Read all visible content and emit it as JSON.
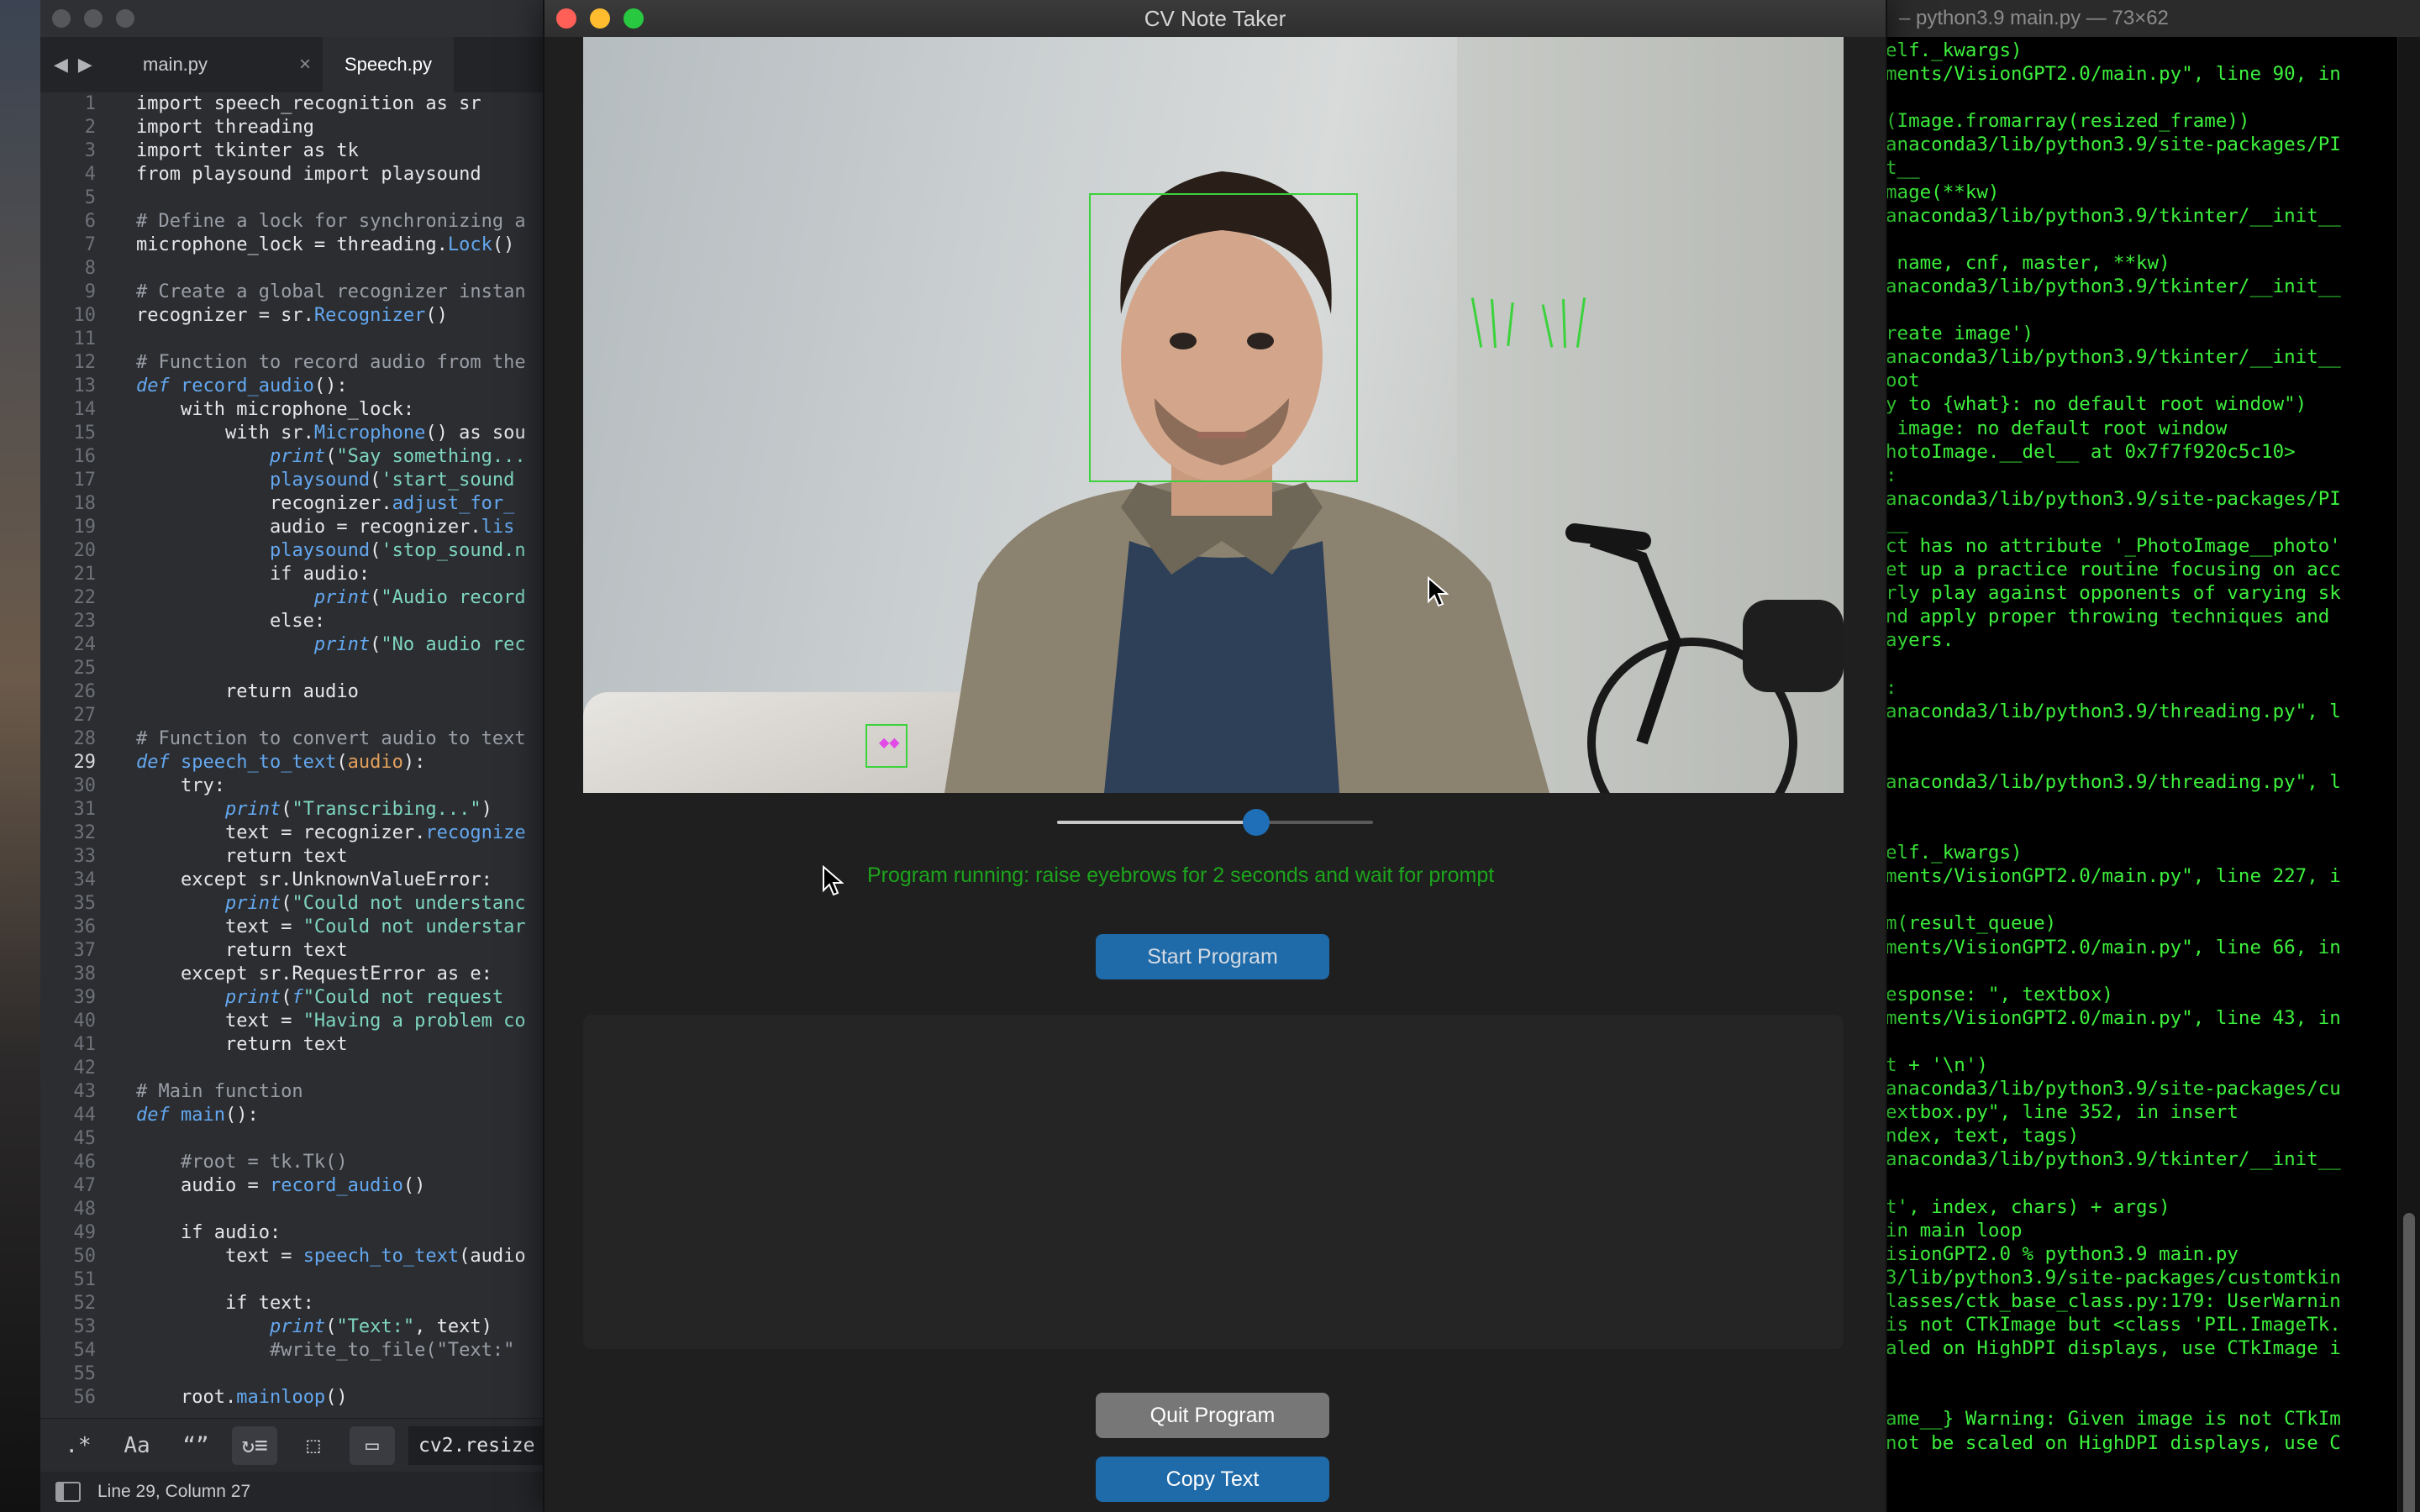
{
  "editor": {
    "tabs": [
      {
        "label": "main.py",
        "close": "×"
      },
      {
        "label": "Speech.py"
      }
    ],
    "current_line": 29,
    "lines": [
      {
        "n": "1",
        "parts": [
          [
            "kw",
            "import speech_recognition as sr"
          ]
        ]
      },
      {
        "n": "2",
        "parts": [
          [
            "kw",
            "import threading"
          ]
        ]
      },
      {
        "n": "3",
        "parts": [
          [
            "kw",
            "import tkinter as tk"
          ]
        ]
      },
      {
        "n": "4",
        "parts": [
          [
            "kw",
            "from playsound import playsound"
          ]
        ]
      },
      {
        "n": "5",
        "parts": []
      },
      {
        "n": "6",
        "parts": [
          [
            "cm",
            "# Define a lock for synchronizing a"
          ]
        ]
      },
      {
        "n": "7",
        "parts": [
          [
            "kw",
            "microphone_lock = threading."
          ],
          [
            "fn",
            "Lock"
          ],
          [
            "kw",
            "()"
          ]
        ]
      },
      {
        "n": "8",
        "parts": []
      },
      {
        "n": "9",
        "parts": [
          [
            "cm",
            "# Create a global recognizer instan"
          ]
        ]
      },
      {
        "n": "10",
        "parts": [
          [
            "kw",
            "recognizer = sr."
          ],
          [
            "fn",
            "Recognizer"
          ],
          [
            "kw",
            "()"
          ]
        ]
      },
      {
        "n": "11",
        "parts": []
      },
      {
        "n": "12",
        "parts": [
          [
            "cm",
            "# Function to record audio from the"
          ]
        ]
      },
      {
        "n": "13",
        "parts": [
          [
            "def",
            "def "
          ],
          [
            "fn",
            "record_audio"
          ],
          [
            "kw",
            "():"
          ]
        ]
      },
      {
        "n": "14",
        "parts": [
          [
            "kw",
            "    with microphone_lock:"
          ]
        ]
      },
      {
        "n": "15",
        "parts": [
          [
            "kw",
            "        with sr."
          ],
          [
            "fn",
            "Microphone"
          ],
          [
            "kw",
            "() as sou"
          ]
        ]
      },
      {
        "n": "16",
        "parts": [
          [
            "kw",
            "            "
          ],
          [
            "pr",
            "print"
          ],
          [
            "kw",
            "("
          ],
          [
            "st",
            "\"Say something..."
          ]
        ]
      },
      {
        "n": "17",
        "parts": [
          [
            "kw",
            "            "
          ],
          [
            "fn",
            "playsound"
          ],
          [
            "kw",
            "("
          ],
          [
            "st",
            "'start_sound"
          ]
        ]
      },
      {
        "n": "18",
        "parts": [
          [
            "kw",
            "            recognizer."
          ],
          [
            "fn",
            "adjust_for_"
          ]
        ]
      },
      {
        "n": "19",
        "parts": [
          [
            "kw",
            "            audio = recognizer."
          ],
          [
            "fn",
            "lis"
          ]
        ]
      },
      {
        "n": "20",
        "parts": [
          [
            "kw",
            "            "
          ],
          [
            "fn",
            "playsound"
          ],
          [
            "kw",
            "("
          ],
          [
            "st",
            "'stop_sound.n"
          ]
        ]
      },
      {
        "n": "21",
        "parts": [
          [
            "kw",
            "            if audio:"
          ]
        ]
      },
      {
        "n": "22",
        "parts": [
          [
            "kw",
            "                "
          ],
          [
            "pr",
            "print"
          ],
          [
            "kw",
            "("
          ],
          [
            "st",
            "\"Audio record"
          ]
        ]
      },
      {
        "n": "23",
        "parts": [
          [
            "kw",
            "            else:"
          ]
        ]
      },
      {
        "n": "24",
        "parts": [
          [
            "kw",
            "                "
          ],
          [
            "pr",
            "print"
          ],
          [
            "kw",
            "("
          ],
          [
            "st",
            "\"No audio rec"
          ]
        ]
      },
      {
        "n": "25",
        "parts": []
      },
      {
        "n": "26",
        "parts": [
          [
            "kw",
            "        return audio"
          ]
        ]
      },
      {
        "n": "27",
        "parts": []
      },
      {
        "n": "28",
        "parts": [
          [
            "cm",
            "# Function to convert audio to text"
          ]
        ]
      },
      {
        "n": "29",
        "parts": [
          [
            "def",
            "def "
          ],
          [
            "fn",
            "speech_to_text"
          ],
          [
            "kw",
            "("
          ],
          [
            "ar",
            "audio"
          ],
          [
            "kw",
            "):"
          ]
        ]
      },
      {
        "n": "30",
        "parts": [
          [
            "kw",
            "    try:"
          ]
        ]
      },
      {
        "n": "31",
        "parts": [
          [
            "kw",
            "        "
          ],
          [
            "pr",
            "print"
          ],
          [
            "kw",
            "("
          ],
          [
            "st",
            "\"Transcribing...\""
          ],
          [
            "kw",
            ")"
          ]
        ]
      },
      {
        "n": "32",
        "parts": [
          [
            "kw",
            "        text = recognizer."
          ],
          [
            "fn",
            "recognize"
          ]
        ]
      },
      {
        "n": "33",
        "parts": [
          [
            "kw",
            "        return text"
          ]
        ]
      },
      {
        "n": "34",
        "parts": [
          [
            "kw",
            "    except sr.UnknownValueError:"
          ]
        ]
      },
      {
        "n": "35",
        "parts": [
          [
            "kw",
            "        "
          ],
          [
            "pr",
            "print"
          ],
          [
            "kw",
            "("
          ],
          [
            "st",
            "\"Could not understanc"
          ]
        ]
      },
      {
        "n": "36",
        "parts": [
          [
            "kw",
            "        text = "
          ],
          [
            "st",
            "\"Could not understar"
          ]
        ]
      },
      {
        "n": "37",
        "parts": [
          [
            "kw",
            "        return text"
          ]
        ]
      },
      {
        "n": "38",
        "parts": [
          [
            "kw",
            "    except sr.RequestError as e:"
          ]
        ]
      },
      {
        "n": "39",
        "parts": [
          [
            "kw",
            "        "
          ],
          [
            "pr",
            "print"
          ],
          [
            "kw",
            "("
          ],
          [
            "pr",
            "f"
          ],
          [
            "st",
            "\"Could not request "
          ]
        ]
      },
      {
        "n": "40",
        "parts": [
          [
            "kw",
            "        text = "
          ],
          [
            "st",
            "\"Having a problem co"
          ]
        ]
      },
      {
        "n": "41",
        "parts": [
          [
            "kw",
            "        return text"
          ]
        ]
      },
      {
        "n": "42",
        "parts": []
      },
      {
        "n": "43",
        "parts": [
          [
            "cm",
            "# Main function"
          ]
        ]
      },
      {
        "n": "44",
        "parts": [
          [
            "def",
            "def "
          ],
          [
            "fn",
            "main"
          ],
          [
            "kw",
            "():"
          ]
        ]
      },
      {
        "n": "45",
        "parts": []
      },
      {
        "n": "46",
        "parts": [
          [
            "cm",
            "    #root = tk.Tk()"
          ]
        ]
      },
      {
        "n": "47",
        "parts": [
          [
            "kw",
            "    audio = "
          ],
          [
            "fn",
            "record_audio"
          ],
          [
            "kw",
            "()"
          ]
        ]
      },
      {
        "n": "48",
        "parts": []
      },
      {
        "n": "49",
        "parts": [
          [
            "kw",
            "    if audio:"
          ]
        ]
      },
      {
        "n": "50",
        "parts": [
          [
            "kw",
            "        text = "
          ],
          [
            "fn",
            "speech_to_text"
          ],
          [
            "kw",
            "(audio"
          ]
        ]
      },
      {
        "n": "51",
        "parts": []
      },
      {
        "n": "52",
        "parts": [
          [
            "kw",
            "        if text:"
          ]
        ]
      },
      {
        "n": "53",
        "parts": [
          [
            "kw",
            "            "
          ],
          [
            "pr",
            "print"
          ],
          [
            "kw",
            "("
          ],
          [
            "st",
            "\"Text:\""
          ],
          [
            "kw",
            ", text)"
          ]
        ]
      },
      {
        "n": "54",
        "parts": [
          [
            "cm",
            "            #write_to_file(\"Text:\""
          ]
        ]
      },
      {
        "n": "55",
        "parts": []
      },
      {
        "n": "56",
        "parts": [
          [
            "kw",
            "    root."
          ],
          [
            "fn",
            "mainloop"
          ],
          [
            "kw",
            "()"
          ]
        ]
      }
    ],
    "toolbar": {
      "regex": ".*",
      "case": "Aa",
      "word": "“”",
      "wrap": "↻≡",
      "selection": "⬚",
      "highlight": "▭",
      "find_value": "cv2.resize"
    },
    "status": "Line 29, Column 27"
  },
  "app": {
    "title": "CV Note Taker",
    "slider_value": 0.63,
    "status": "Program running: raise eyebrows for 2 seconds and wait for prompt",
    "start_button": "Start Program",
    "quit_button": "Quit Program",
    "copy_button": "Copy Text",
    "textbox_value": "",
    "colors": {
      "accent": "#1f6aa8",
      "status_text": "#1da41d",
      "detection_box": "#3bd23b"
    }
  },
  "terminal": {
    "title": "– python3.9 main.py — 73×62",
    "lines": [
      "elf._kwargs)",
      "ments/VisionGPT2.0/main.py\", line 90, in",
      "",
      "(Image.fromarray(resized_frame))",
      "anaconda3/lib/python3.9/site-packages/PI",
      "t__",
      "mage(**kw)",
      "anaconda3/lib/python3.9/tkinter/__init__",
      "",
      " name, cnf, master, **kw)",
      "anaconda3/lib/python3.9/tkinter/__init__",
      "",
      "reate image')",
      "anaconda3/lib/python3.9/tkinter/__init__",
      "oot",
      "y to {what}: no default root window\")",
      " image: no default root window",
      "hotoImage.__del__ at 0x7f7f920c5c10>",
      ":",
      "anaconda3/lib/python3.9/site-packages/PI",
      "__",
      "ct has no attribute '_PhotoImage__photo'",
      "et up a practice routine focusing on acc",
      "rly play against opponents of varying sk",
      "nd apply proper throwing techniques and",
      "ayers.",
      "",
      ":",
      "anaconda3/lib/python3.9/threading.py\", l",
      "",
      "",
      "anaconda3/lib/python3.9/threading.py\", l",
      "",
      "",
      "elf._kwargs)",
      "ments/VisionGPT2.0/main.py\", line 227, i",
      "",
      "m(result_queue)",
      "ments/VisionGPT2.0/main.py\", line 66, in",
      "",
      "esponse: \", textbox)",
      "ments/VisionGPT2.0/main.py\", line 43, in",
      "",
      "t + '\\n')",
      "anaconda3/lib/python3.9/site-packages/cu",
      "extbox.py\", line 352, in insert",
      "ndex, text, tags)",
      "anaconda3/lib/python3.9/tkinter/__init__",
      "",
      "t', index, chars) + args)",
      "in main loop",
      "isionGPT2.0 % python3.9 main.py",
      "3/lib/python3.9/site-packages/customtkin",
      "lasses/ctk_base_class.py:179: UserWarnin",
      "is not CTkImage but <class 'PIL.ImageTk.",
      "aled on HighDPI displays, use CTkImage i",
      "",
      "",
      "ame__} Warning: Given image is not CTkIm",
      "not be scaled on HighDPI displays, use C"
    ]
  }
}
